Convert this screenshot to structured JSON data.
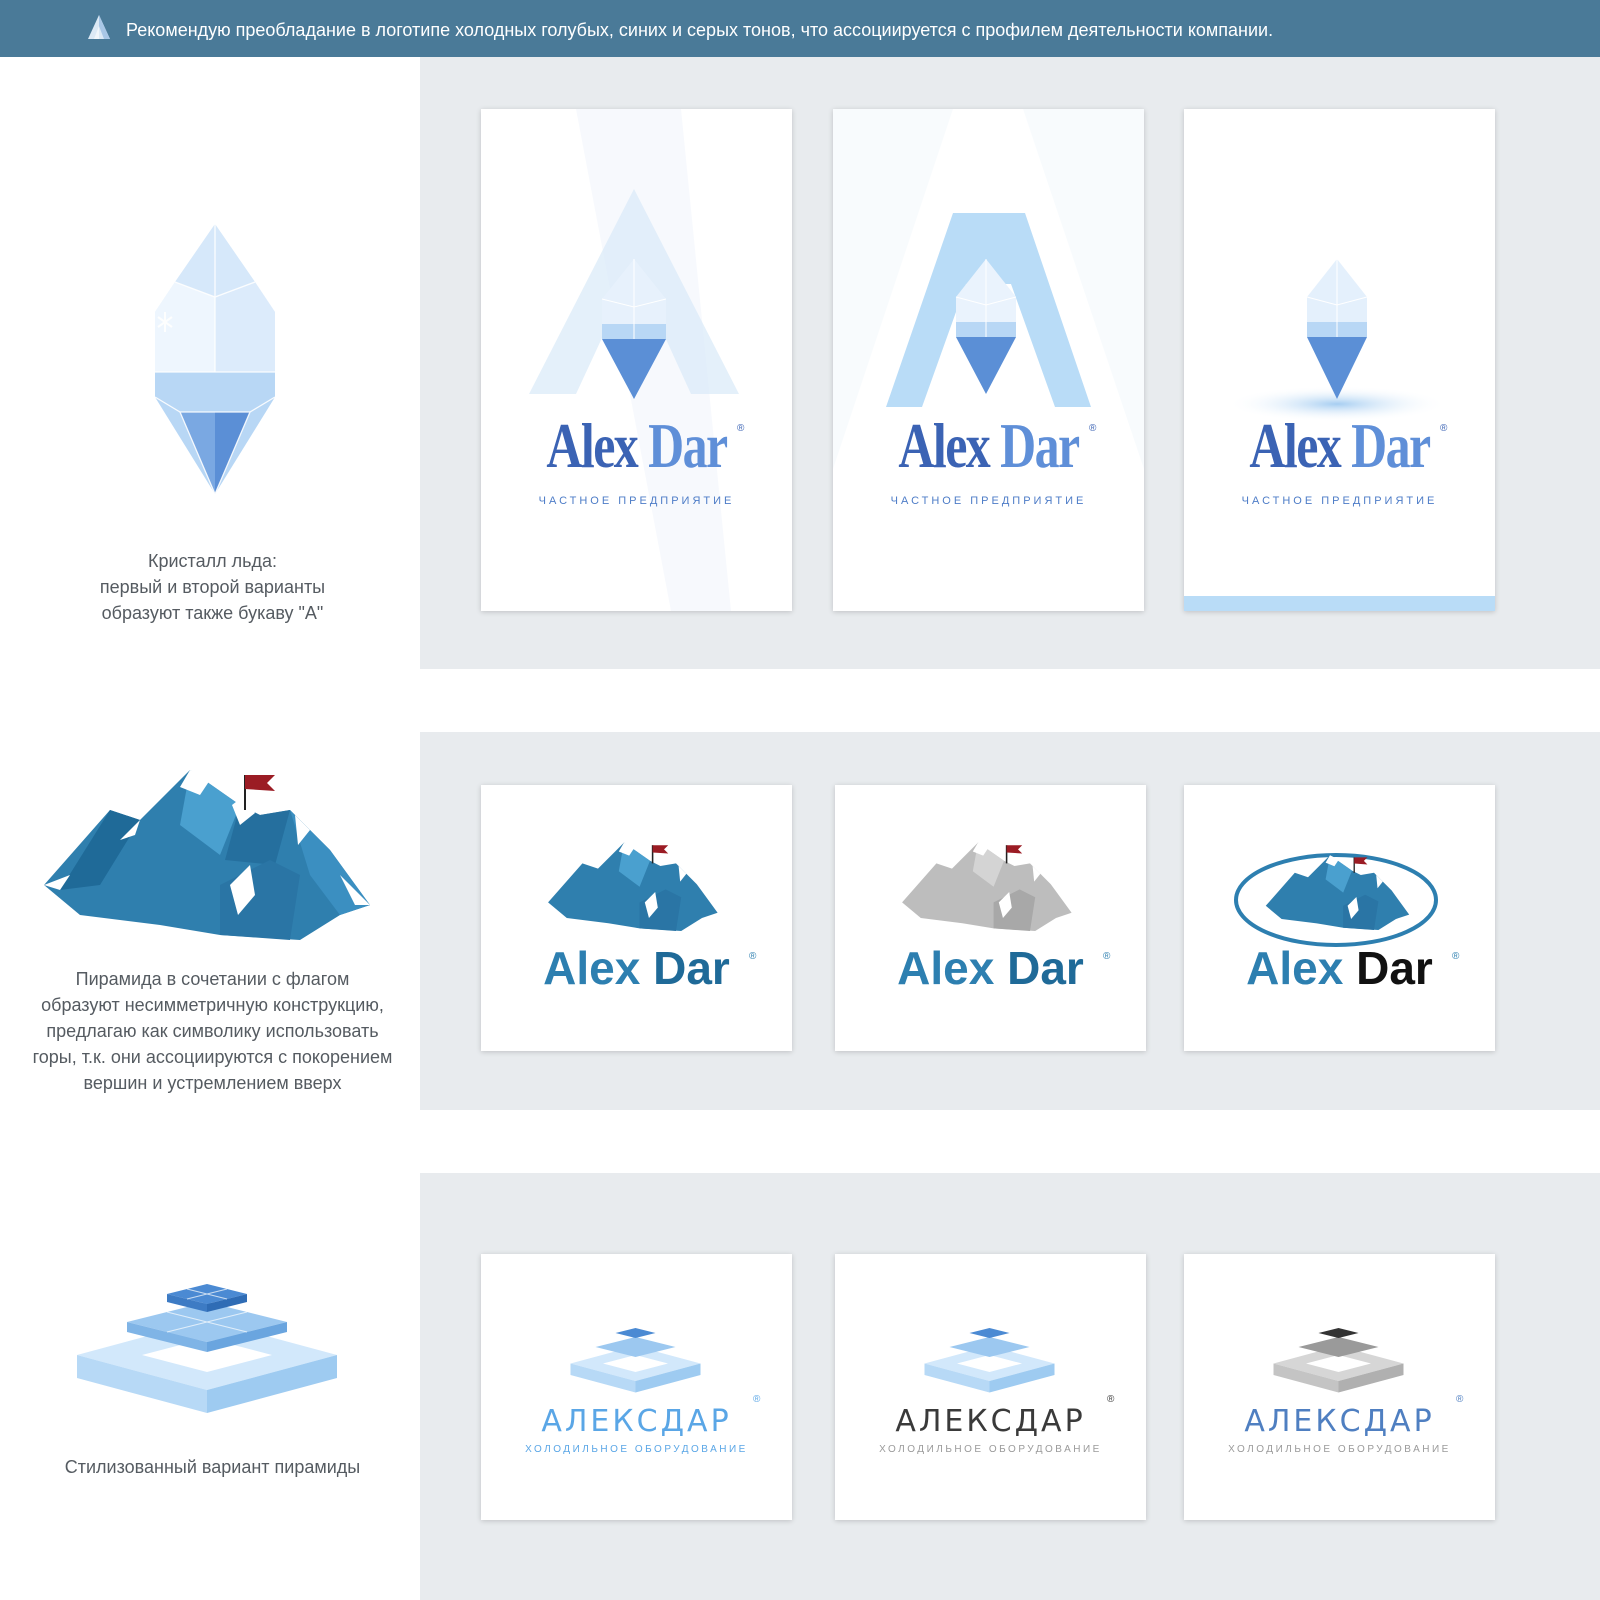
{
  "banner": {
    "text": "Рекомендую преобладание в логотипе холодных голубых, синих и серых тонов, что ассоциируется с профилем деятельности компании."
  },
  "colors": {
    "banner": "#4a7a98",
    "panel": "#e8ebee",
    "ice_light": "#cfe6fb",
    "ice_mid": "#9cc8f0",
    "ice_dark": "#5b8fd6",
    "mountain": "#2f7fae",
    "flag": "#9b1c24",
    "brand_blue": "#3b63b4",
    "gray": "#9a9a9a",
    "black": "#222222"
  },
  "sections": [
    {
      "caption": [
        "Кристалл льда:",
        "первый и второй варианты",
        "образуют также букаву \"А\""
      ],
      "icon": "ice-crystal-icon",
      "cards": [
        {
          "variant": "crystal-light-a",
          "title_a": "Alex",
          "title_b": "Dar",
          "reg": "®",
          "subtitle": "ЧАСТНОЕ ПРЕДПРИЯТИЕ"
        },
        {
          "variant": "crystal-solid-a",
          "title_a": "Alex",
          "title_b": "Dar",
          "reg": "®",
          "subtitle": "ЧАСТНОЕ ПРЕДПРИЯТИЕ"
        },
        {
          "variant": "crystal-glow",
          "title_a": "Alex",
          "title_b": "Dar",
          "reg": "®",
          "subtitle": "ЧАСТНОЕ ПРЕДПРИЯТИЕ"
        }
      ]
    },
    {
      "caption": [
        "Пирамида в сочетании с флагом",
        "образуют несимметричную конструкцию,",
        "предлагаю как символику использовать",
        "горы, т.к. они ассоциируются с покорением",
        "вершин и устремлением вверх"
      ],
      "icon": "mountain-flag-icon",
      "cards": [
        {
          "variant": "mountain-blue",
          "title_a": "Alex",
          "title_b": "Dar",
          "reg": "®"
        },
        {
          "variant": "mountain-gray",
          "title_a": "Alex",
          "title_b": "Dar",
          "reg": "®"
        },
        {
          "variant": "mountain-oval",
          "title_a": "Alex",
          "title_b": "Dar",
          "reg": "®"
        }
      ]
    },
    {
      "caption": [
        "Стилизованный вариант пирамиды"
      ],
      "icon": "stepped-pyramid-icon",
      "cards": [
        {
          "variant": "pyramid-blue",
          "title": "АЛЕКСДАР",
          "reg": "®",
          "subtitle": "ХОЛОДИЛЬНОЕ ОБОРУДОВАНИЕ"
        },
        {
          "variant": "pyramid-dark",
          "title": "АЛЕКСДАР",
          "reg": "®",
          "subtitle": "ХОЛОДИЛЬНОЕ ОБОРУДОВАНИЕ"
        },
        {
          "variant": "pyramid-gray",
          "title": "АЛЕКСДАР",
          "reg": "®",
          "subtitle": "ХОЛОДИЛЬНОЕ ОБОРУДОВАНИЕ"
        }
      ]
    }
  ]
}
